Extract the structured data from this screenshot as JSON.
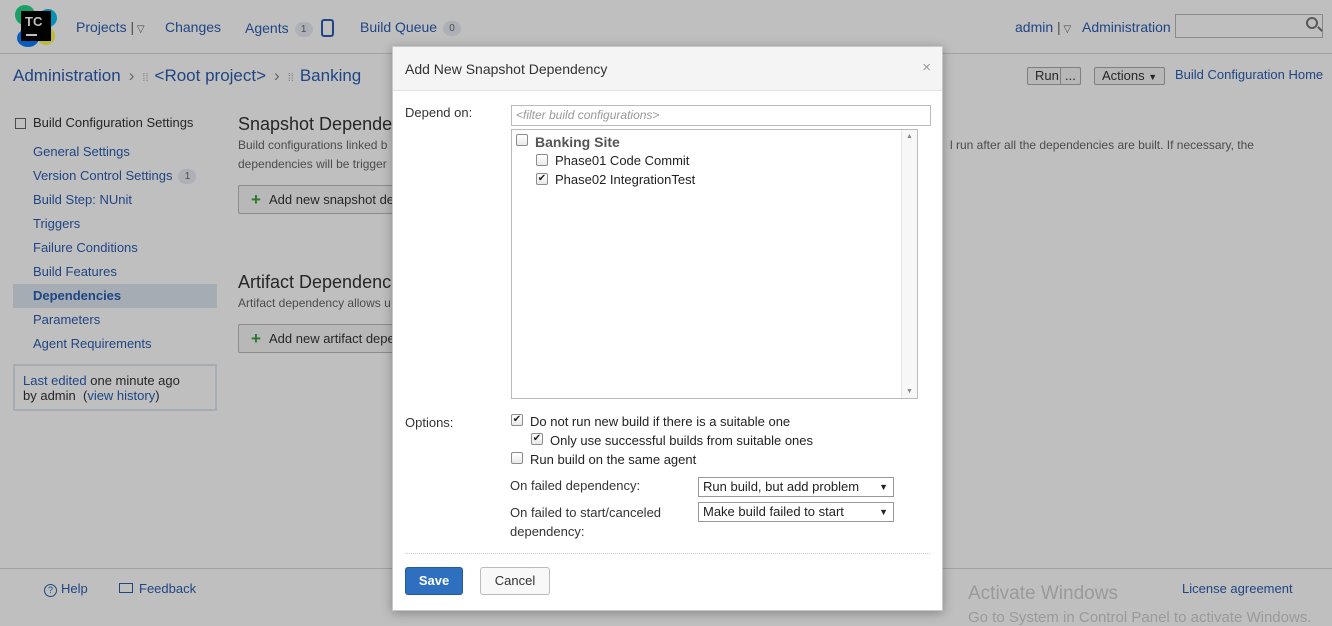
{
  "topbar": {
    "projects": "Projects",
    "changes": "Changes",
    "agents": "Agents",
    "agents_count": "1",
    "build_queue": "Build Queue",
    "build_queue_count": "0",
    "user": "admin",
    "administration": "Administration",
    "search_placeholder": ""
  },
  "breadcrumb": {
    "root": "Administration",
    "project": "<Root project>",
    "current": "Banking"
  },
  "header_actions": {
    "run": "Run",
    "run_more": "...",
    "actions": "Actions",
    "build_config_home": "Build Configuration Home"
  },
  "sidebar": {
    "heading": "Build Configuration Settings",
    "items": [
      {
        "label": "General Settings"
      },
      {
        "label": "Version Control Settings",
        "badge": "1"
      },
      {
        "label": "Build Step: NUnit"
      },
      {
        "label": "Triggers"
      },
      {
        "label": "Failure Conditions"
      },
      {
        "label": "Build Features"
      },
      {
        "label": "Dependencies",
        "active": true
      },
      {
        "label": "Parameters"
      },
      {
        "label": "Agent Requirements"
      }
    ],
    "last_edited_link": "Last edited",
    "last_edited_when": "one minute ago",
    "by": "by admin",
    "view_history": "view history"
  },
  "main": {
    "snapshot_title": "Snapshot Depende",
    "snapshot_desc_1": "Build configurations linked b",
    "snapshot_desc_2": "dependencies will be trigger",
    "snapshot_desc_right": "l run after all the dependencies are built. If necessary, the",
    "add_snapshot": "Add new snapshot de",
    "artifact_title": "Artifact Dependenc",
    "artifact_desc": "Artifact dependency allows u",
    "add_artifact": "Add new artifact depe"
  },
  "footer": {
    "help": "Help",
    "feedback": "Feedback",
    "license": "License agreement",
    "activate_1": "Activate Windows",
    "activate_2": "Go to System in Control Panel to activate Windows."
  },
  "dialog": {
    "title": "Add New Snapshot Dependency",
    "close": "×",
    "depend_on_label": "Depend on:",
    "filter_placeholder": "<filter build configurations>",
    "tree": {
      "project": {
        "label": "Banking Site",
        "checked": false
      },
      "configs": [
        {
          "label": "Phase01 Code Commit",
          "checked": false
        },
        {
          "label": "Phase02 IntegrationTest",
          "checked": true
        }
      ]
    },
    "options_label": "Options:",
    "options": [
      {
        "label": "Do not run new build if there is a suitable one",
        "checked": true
      },
      {
        "label": "Only use successful builds from suitable ones",
        "checked": true
      },
      {
        "label": "Run build on the same agent",
        "checked": false
      }
    ],
    "on_failed_dep_label": "On failed dependency:",
    "on_failed_dep_value": "Run build, but add problem",
    "on_failed_start_label_1": "On failed to start/canceled",
    "on_failed_start_label_2": "dependency:",
    "on_failed_start_value": "Make build failed to start",
    "save": "Save",
    "cancel": "Cancel"
  }
}
